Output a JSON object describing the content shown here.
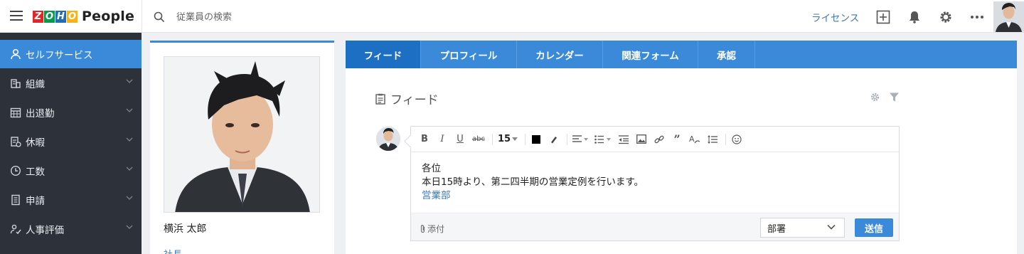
{
  "app": {
    "logo_letters": [
      "Z",
      "O",
      "H",
      "O"
    ],
    "logo_colors": [
      "#e42527",
      "#089949",
      "#226db4",
      "#f9b21d"
    ],
    "product": "People"
  },
  "topbar": {
    "search_placeholder": "従業員の検索",
    "license_label": "ライセンス"
  },
  "sidebar": {
    "items": [
      {
        "label": "セルフサービス",
        "icon": "user-icon",
        "active": true
      },
      {
        "label": "組織",
        "icon": "building-icon"
      },
      {
        "label": "出退勤",
        "icon": "calendar-grid-icon"
      },
      {
        "label": "休暇",
        "icon": "leave-icon"
      },
      {
        "label": "工数",
        "icon": "clock-icon"
      },
      {
        "label": "申請",
        "icon": "document-icon"
      },
      {
        "label": "人事評価",
        "icon": "appraisal-icon"
      }
    ]
  },
  "profile": {
    "name": "横浜 太郎",
    "title": "社長"
  },
  "tabs": [
    {
      "label": "フィード",
      "active": true
    },
    {
      "label": "プロフィール"
    },
    {
      "label": "カレンダー"
    },
    {
      "label": "関連フォーム"
    },
    {
      "label": "承認"
    }
  ],
  "feed": {
    "title": "フィード",
    "toolbar": {
      "font_size": "15"
    },
    "message": {
      "line1": "各位",
      "line2": "本日15時より、第二四半期の営業定例を行います。",
      "link": "営業部"
    },
    "attach_label": "添付",
    "dept_value": "部署",
    "send_label": "送信"
  },
  "colors": {
    "accent": "#3b8ad9",
    "sidebar_bg": "#2c313a",
    "link": "#3c77b8"
  }
}
